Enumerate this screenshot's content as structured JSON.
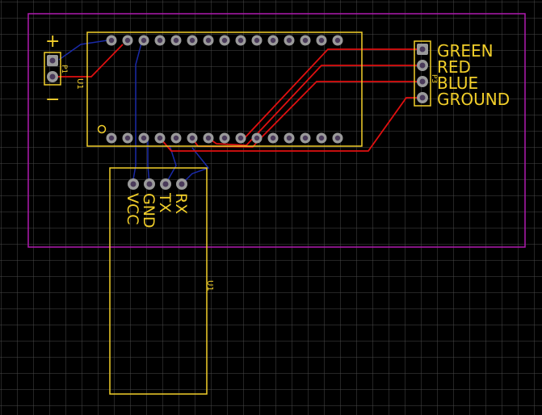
{
  "colors": {
    "background": "#000000",
    "grid": "#4a4a4a",
    "board_outline": "#b01ab0",
    "silkscreen": "#f2cf2a",
    "top_copper": "#e01010",
    "bottom_copper": "#1a2aa8",
    "pad_outer": "#9a9a9a",
    "pad_inner": "#4a3a5a"
  },
  "power_connector": {
    "ref": "P1",
    "plus_label": "+",
    "minus_label": "−"
  },
  "mcu": {
    "ref": "U1",
    "pins_per_row": 15
  },
  "led_connector": {
    "ref": "P3",
    "labels": [
      "GREEN",
      "RED",
      "BLUE",
      "GROUND"
    ]
  },
  "bluetooth_module": {
    "ref": "U1",
    "labels": [
      "VCC",
      "GND",
      "TX",
      "RX"
    ]
  }
}
